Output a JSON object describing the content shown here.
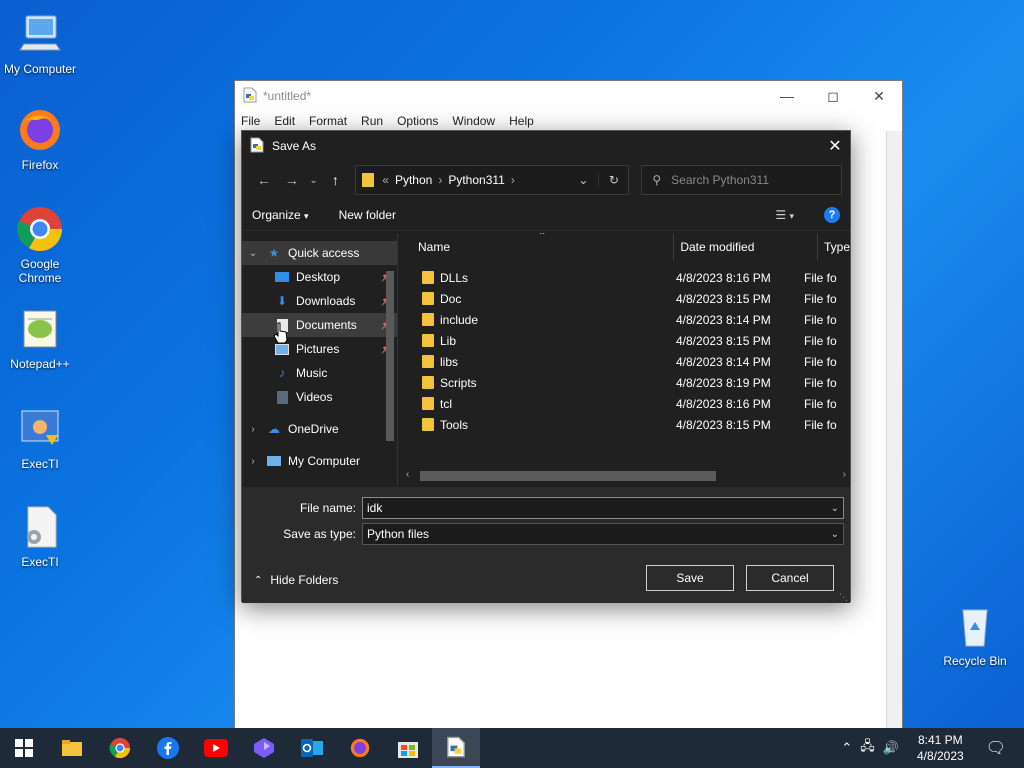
{
  "desktop": {
    "icons": [
      {
        "label": "My Computer"
      },
      {
        "label": "Firefox"
      },
      {
        "label": "Google Chrome"
      },
      {
        "label": "Notepad++"
      },
      {
        "label": "ExecTI"
      },
      {
        "label": "ExecTI"
      },
      {
        "label": "Recycle Bin"
      }
    ]
  },
  "editor": {
    "title": "*untitled*",
    "menu": [
      "File",
      "Edit",
      "Format",
      "Run",
      "Options",
      "Window",
      "Help"
    ]
  },
  "dialog": {
    "title": "Save As",
    "breadcrumb": {
      "overflow": "«",
      "items": [
        "Python",
        "Python311"
      ]
    },
    "search_placeholder": "Search Python311",
    "toolbar": {
      "organize": "Organize",
      "new_folder": "New folder",
      "help": "?"
    },
    "nav": {
      "quick_access": "Quick access",
      "items": [
        "Desktop",
        "Downloads",
        "Documents",
        "Pictures",
        "Music",
        "Videos"
      ],
      "onedrive": "OneDrive",
      "my_computer": "My Computer"
    },
    "columns": {
      "name": "Name",
      "date": "Date modified",
      "type": "Type"
    },
    "files": [
      {
        "name": "DLLs",
        "date": "4/8/2023 8:16 PM",
        "type": "File fo"
      },
      {
        "name": "Doc",
        "date": "4/8/2023 8:15 PM",
        "type": "File fo"
      },
      {
        "name": "include",
        "date": "4/8/2023 8:14 PM",
        "type": "File fo"
      },
      {
        "name": "Lib",
        "date": "4/8/2023 8:15 PM",
        "type": "File fo"
      },
      {
        "name": "libs",
        "date": "4/8/2023 8:14 PM",
        "type": "File fo"
      },
      {
        "name": "Scripts",
        "date": "4/8/2023 8:19 PM",
        "type": "File fo"
      },
      {
        "name": "tcl",
        "date": "4/8/2023 8:16 PM",
        "type": "File fo"
      },
      {
        "name": "Tools",
        "date": "4/8/2023 8:15 PM",
        "type": "File fo"
      }
    ],
    "file_name_label": "File name:",
    "file_name_value": "idk",
    "save_type_label": "Save as type:",
    "save_type_value": "Python files",
    "hide_folders": "Hide Folders",
    "save": "Save",
    "cancel": "Cancel"
  },
  "taskbar": {
    "time": "8:41 PM",
    "date": "4/8/2023"
  },
  "colors": {
    "accent": "#1d7cf2",
    "folder": "#f4c33c",
    "dialog_bg": "#202020"
  }
}
